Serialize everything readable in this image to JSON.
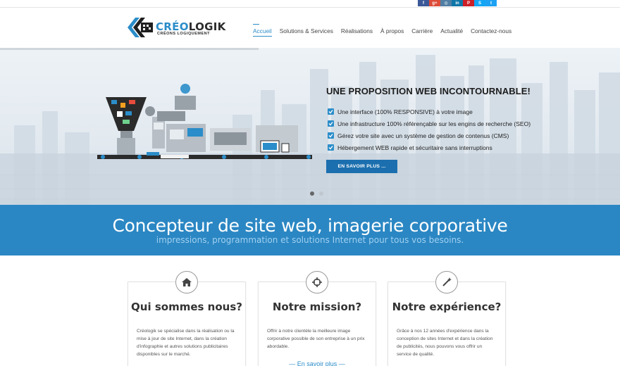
{
  "social": [
    {
      "name": "facebook",
      "glyph": "f",
      "color": "#3b5998"
    },
    {
      "name": "google-plus",
      "glyph": "g+",
      "color": "#dd4b39"
    },
    {
      "name": "instagram",
      "glyph": "◎",
      "color": "#517fa4"
    },
    {
      "name": "linkedin",
      "glyph": "in",
      "color": "#0e76a8"
    },
    {
      "name": "pinterest",
      "glyph": "P",
      "color": "#cb2027"
    },
    {
      "name": "skype",
      "glyph": "S",
      "color": "#12a5f4"
    },
    {
      "name": "twitter",
      "glyph": "t",
      "color": "#1da1f2"
    }
  ],
  "brand": {
    "title_accent": "CRÉO",
    "title_rest": "LOGIK",
    "subtitle": "CRÉONS LOGIQUEMENT",
    "accent_color": "#2b8dc9"
  },
  "nav": [
    "Accueil",
    "Solutions & Services",
    "Réalisations",
    "À propos",
    "Carrière",
    "Actualité",
    "Contactez-nous"
  ],
  "hero": {
    "title": "UNE PROPOSITION WEB INCONTOURNABLE!",
    "bullets": [
      "Une interface (100% RESPONSIVE) à votre image",
      "Une infrastructure 100% référençable sur les engins de recherche (SEO)",
      "Gérez votre site avec un système de gestion de contenus (CMS)",
      "Hébergement WEB rapide et sécuritaire sans interruptions"
    ],
    "cta": "EN SAVOIR PLUS ...",
    "slides": 2,
    "active_slide": 1
  },
  "band": {
    "title": "Concepteur de site web, imagerie corporative",
    "subtitle": "impressions, programmation et solutions Internet pour tous vos besoins."
  },
  "cards": [
    {
      "icon": "home-icon",
      "title": "Qui sommes nous?",
      "text": "Créologik se spécialise dans la réalisation ou la mise à jour de site Internet, dans la création d'infographie et autres solutions publicitaires disponibles sur le marché.",
      "link": ""
    },
    {
      "icon": "crosshair-icon",
      "title": "Notre mission?",
      "text": "Offrir à notre clientèle la meilleure image corporative possible de son entreprise à un prix abordable.",
      "link": "— En savoir plus —"
    },
    {
      "icon": "magic-wand-icon",
      "title": "Notre expérience?",
      "text": "Grâce à nos 12 années d'expérience dans la conception de sites Internet et dans la création de publicités, nous pouvons vous offrir un service de qualité.",
      "link": ""
    }
  ]
}
